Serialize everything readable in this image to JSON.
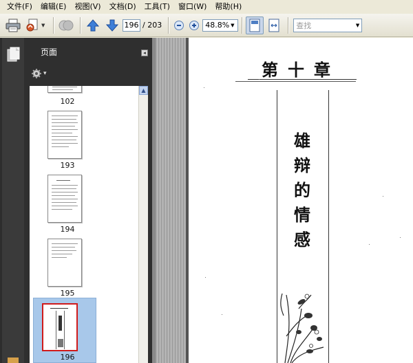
{
  "menu": [
    "文件(F)",
    "编辑(E)",
    "视图(V)",
    "文档(D)",
    "工具(T)",
    "窗口(W)",
    "帮助(H)"
  ],
  "toolbar": {
    "page_current": "196",
    "page_total": "/ 203",
    "zoom": "48.8%",
    "search_placeholder": "查找"
  },
  "panel": {
    "title": "页面",
    "thumbnails": [
      {
        "label": "102"
      },
      {
        "label": "193"
      },
      {
        "label": "194"
      },
      {
        "label": "195"
      },
      {
        "label": "196",
        "selected": true
      }
    ]
  },
  "document": {
    "chapter": "第十章",
    "title_chars": [
      "雄",
      "辩",
      "的",
      "情",
      "感"
    ]
  },
  "colors": {
    "selection_border": "#d01a1a",
    "selection_fill": "#a8c8ea",
    "panel_dark": "#2f2f2f"
  }
}
